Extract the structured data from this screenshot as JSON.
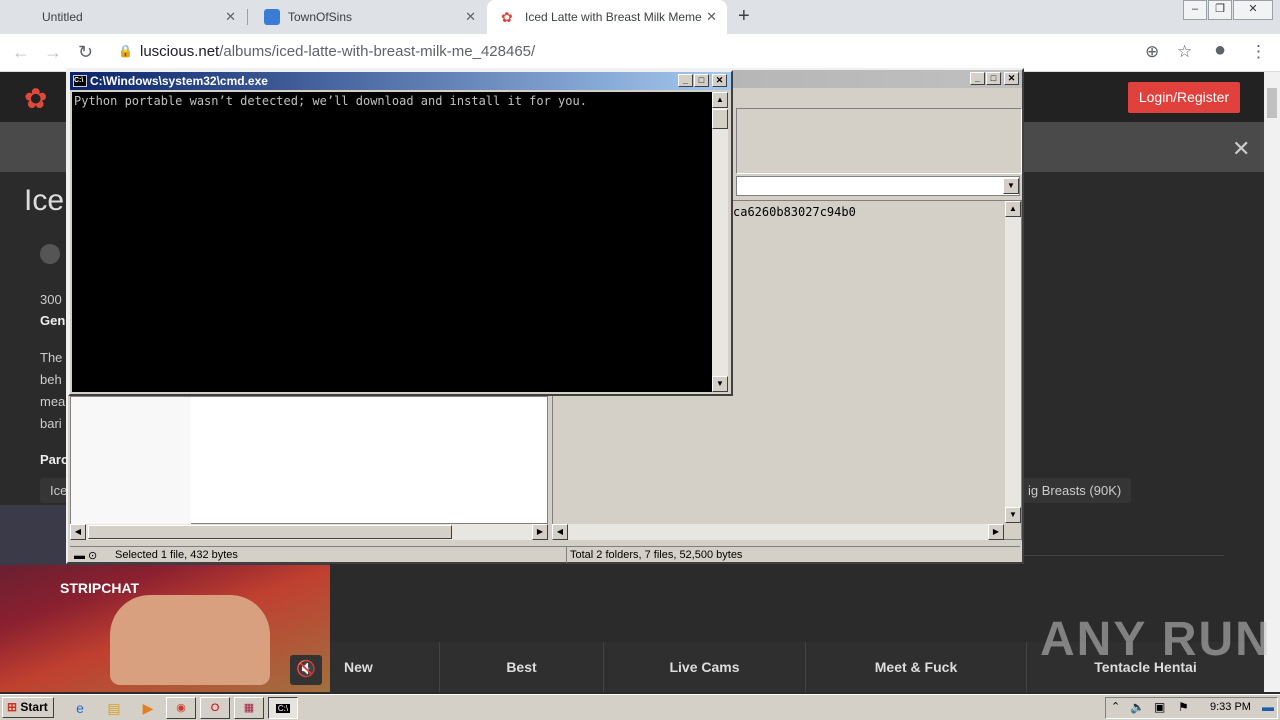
{
  "browser": {
    "tabs": [
      {
        "title": "Untitled"
      },
      {
        "title": "TownOfSins"
      },
      {
        "title": "Iced Latte with Breast Milk Meme | Lu"
      }
    ],
    "url_host": "luscious.net",
    "url_path": "/albums/iced-latte-with-breast-milk-me_428465/"
  },
  "site": {
    "login_label": "Login/Register",
    "title_fragment": "Ice",
    "text_fragments": [
      "300",
      "Gen",
      "The",
      "beh",
      "mea",
      "bari",
      "Parc"
    ],
    "tag_left": "Ice",
    "tag_right": "ig Breasts (90K)",
    "footer_nav": [
      "New",
      "Best",
      "Live Cams",
      "Meet & Fuck",
      "Tentacle Hentai"
    ],
    "cam_brand": "STRIPCHAT",
    "watermark": "ANY RUN"
  },
  "explorer": {
    "hash_fragment": "ca6260b83027c94b0",
    "status_left": "Selected 1 file, 432 bytes",
    "status_right": "Total 2 folders, 7 files, 52,500 bytes"
  },
  "cmd": {
    "title": "C:\\Windows\\system32\\cmd.exe",
    "output": "Python portable wasn’t detected; we’ll download and install it for you."
  },
  "taskbar": {
    "start_label": "Start",
    "clock": "9:33 PM"
  }
}
